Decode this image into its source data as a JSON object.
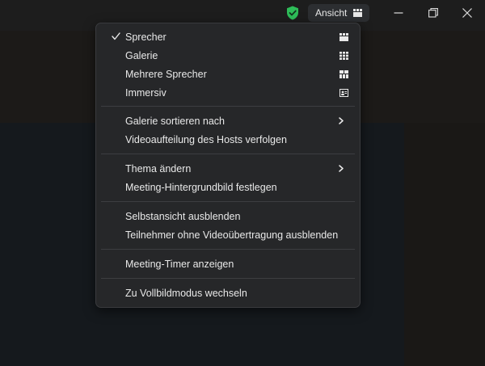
{
  "titlebar": {
    "view_button_label": "Ansicht"
  },
  "menu": {
    "sections": [
      [
        {
          "label": "Sprecher",
          "checked": true,
          "icon": "speaker-layout-icon"
        },
        {
          "label": "Galerie",
          "icon": "gallery-layout-icon"
        },
        {
          "label": "Mehrere Sprecher",
          "icon": "multi-speaker-layout-icon"
        },
        {
          "label": "Immersiv",
          "icon": "immersive-layout-icon"
        }
      ],
      [
        {
          "label": "Galerie sortieren nach",
          "submenu": true
        },
        {
          "label": "Videoaufteilung des Hosts verfolgen"
        }
      ],
      [
        {
          "label": "Thema ändern",
          "submenu": true
        },
        {
          "label": "Meeting-Hintergrundbild festlegen"
        }
      ],
      [
        {
          "label": "Selbstansicht ausblenden"
        },
        {
          "label": "Teilnehmer ohne Videoübertragung ausblenden"
        }
      ],
      [
        {
          "label": "Meeting-Timer anzeigen"
        }
      ],
      [
        {
          "label": "Zu Vollbildmodus wechseln"
        }
      ]
    ]
  },
  "colors": {
    "shield": "#2ebd59",
    "menu_bg": "#262729",
    "separator": "#3d3e41"
  }
}
